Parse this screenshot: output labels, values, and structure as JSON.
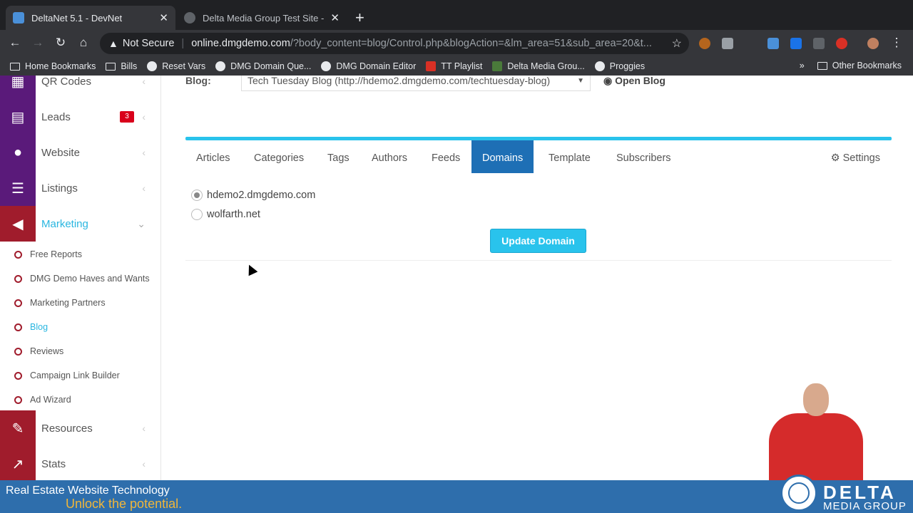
{
  "browser": {
    "tabs": [
      {
        "title": "DeltaNet 5.1 - DevNet",
        "close": "✕"
      },
      {
        "title": "Delta Media Group Test Site - T",
        "close": "✕"
      }
    ],
    "new_tab": "+",
    "security_label": "Not Secure",
    "url_host": "online.dmgdemo.com",
    "url_path": "/?body_content=blog/Control.php&blogAction=&lm_area=51&sub_area=20&t...",
    "bookmarks": [
      "Home Bookmarks",
      "Bills",
      "Reset Vars",
      "DMG Domain Que...",
      "DMG Domain Editor",
      "TT Playlist",
      "Delta Media Grou...",
      "Proggies"
    ],
    "overflow": "»",
    "other_bookmarks": "Other Bookmarks"
  },
  "sidebar": {
    "items": [
      {
        "label": "QR Codes",
        "color": "#5a1a7a",
        "icon": "qr-icon"
      },
      {
        "label": "Leads",
        "badge": "3",
        "color": "#5a1a7a",
        "icon": "leads-icon"
      },
      {
        "label": "Website",
        "color": "#5a1a7a",
        "icon": "globe-icon"
      },
      {
        "label": "Listings",
        "color": "#5a1a7a",
        "icon": "list-icon"
      },
      {
        "label": "Marketing",
        "color": "#a01c2c",
        "icon": "megaphone-icon"
      }
    ],
    "sub_items": [
      "Free Reports",
      "DMG Demo Haves and Wants",
      "Marketing Partners",
      "Blog",
      "Reviews",
      "Campaign Link Builder",
      "Ad Wizard"
    ],
    "bottom_items": [
      {
        "label": "Resources",
        "color": "#a01c2c",
        "icon": "wrench-icon"
      },
      {
        "label": "Stats",
        "color": "#a01c2c",
        "icon": "chart-icon"
      }
    ]
  },
  "main": {
    "blog_label": "Blog:",
    "blog_select": "Tech Tuesday Blog (http://hdemo2.dmgdemo.com/techtuesday-blog)",
    "open_blog": "Open Blog",
    "tabs": [
      "Articles",
      "Categories",
      "Tags",
      "Authors",
      "Feeds",
      "Domains",
      "Template",
      "Subscribers"
    ],
    "active_tab": "Domains",
    "settings": "Settings",
    "domains": [
      {
        "name": "hdemo2.dmgdemo.com",
        "selected": true
      },
      {
        "name": "wolfarth.net",
        "selected": false
      }
    ],
    "update_button": "Update Domain"
  },
  "footer": {
    "tagline_1": "Real Estate Website Technology",
    "tagline_2": "Unlock the potential.",
    "brand_name": "DELTA",
    "brand_sub": "MEDIA GROUP"
  }
}
